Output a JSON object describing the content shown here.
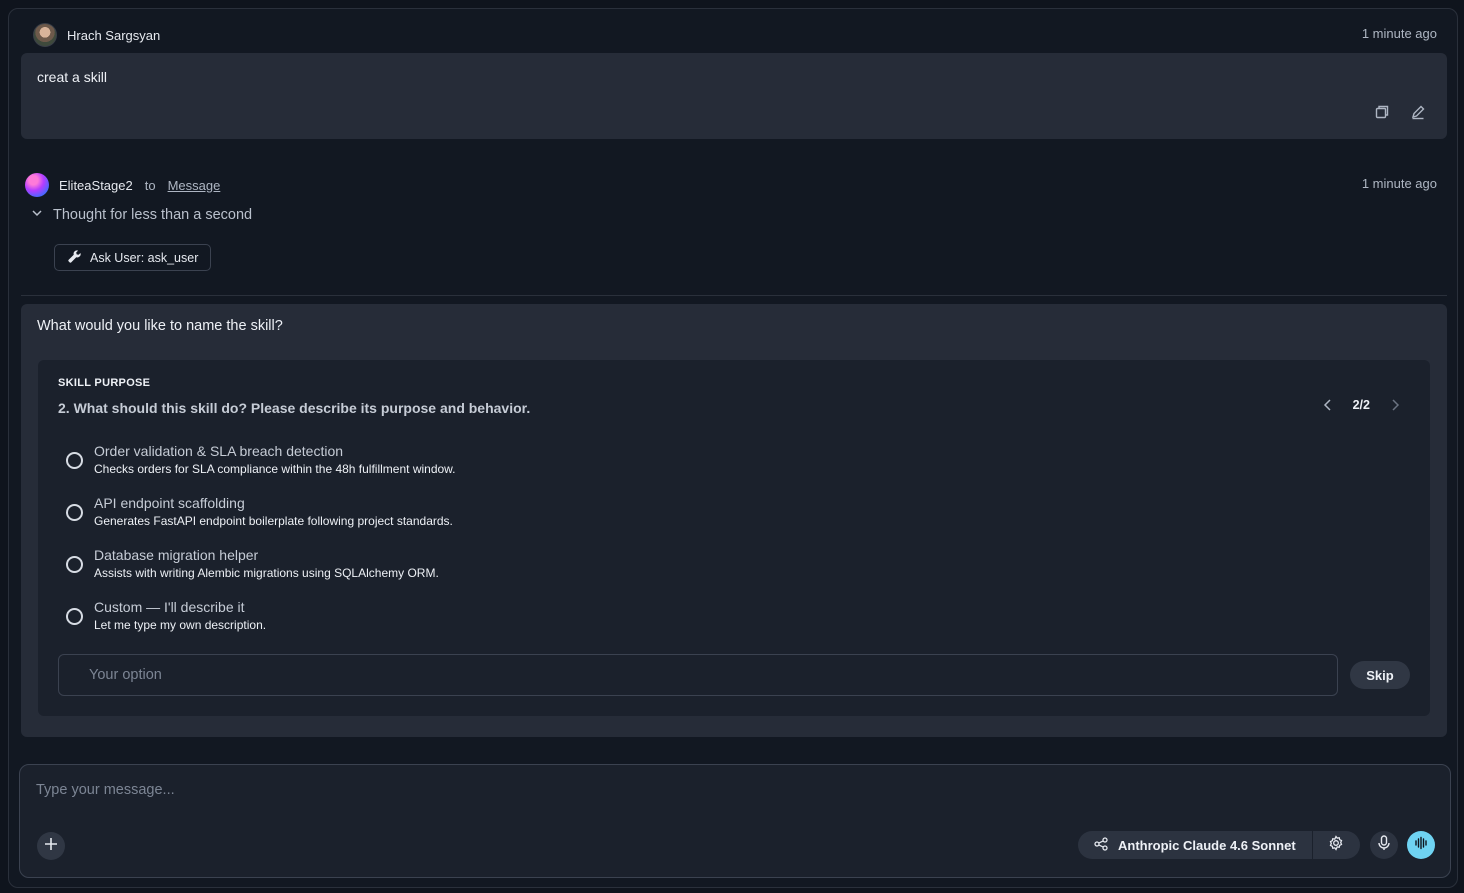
{
  "user_message": {
    "author": "Hrach Sargsyan",
    "timestamp": "1 minute ago",
    "text": "creat a skill",
    "actions": [
      "copy-icon",
      "edit-icon"
    ]
  },
  "agent_message": {
    "author": "EliteaStage2",
    "to_label": "to",
    "target_link": "Message",
    "timestamp": "1 minute ago",
    "thought_label": "Thought for less than a second",
    "tool_chip": "Ask User: ask_user"
  },
  "question": {
    "title": "What would you like to name the skill?",
    "section_label": "SKILL PURPOSE",
    "prompt": "2. What should this skill do? Please describe its purpose and behavior.",
    "pager": "2/2",
    "options": [
      {
        "title": "Order validation & SLA breach detection",
        "description": "Checks orders for SLA compliance within the 48h fulfillment window."
      },
      {
        "title": "API endpoint scaffolding",
        "description": "Generates FastAPI endpoint boilerplate following project standards."
      },
      {
        "title": "Database migration helper",
        "description": "Assists with writing Alembic migrations using SQLAlchemy ORM."
      },
      {
        "title": "Custom — I'll describe it",
        "description": "Let me type my own description."
      }
    ],
    "your_option_placeholder": "Your option",
    "skip_label": "Skip"
  },
  "composer": {
    "placeholder": "Type your message...",
    "model_label": "Anthropic Claude 4.6 Sonnet",
    "voice_color": "#6fd3f2"
  }
}
